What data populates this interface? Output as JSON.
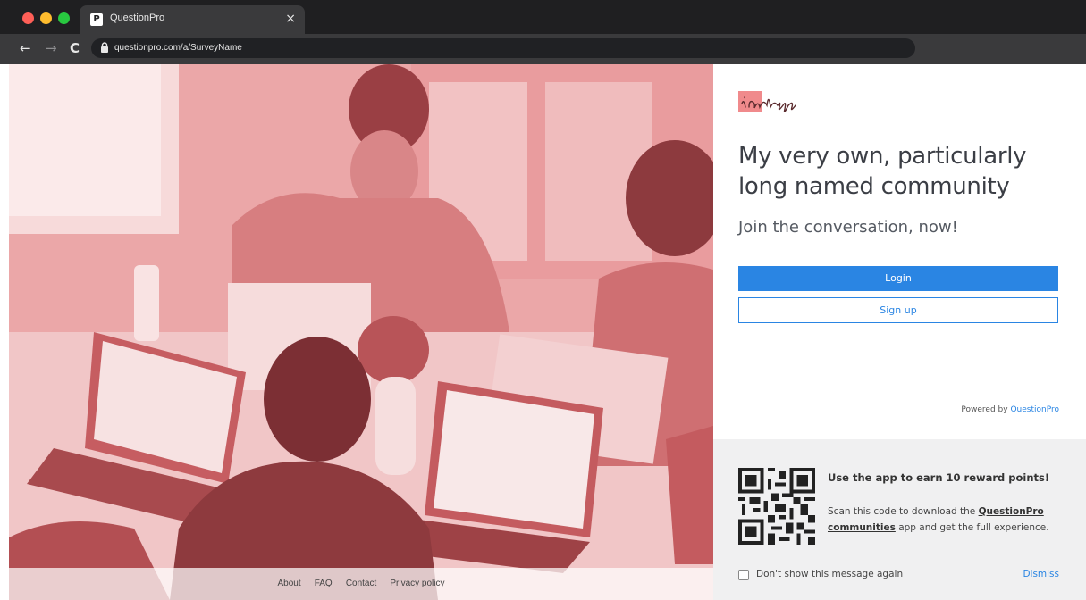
{
  "browser": {
    "tab_title": "QuestionPro",
    "tab_favicon": "P",
    "tab_close": "×",
    "url": "questionpro.com/a/SurveyName",
    "icons": [
      "back-arrow-icon",
      "forward-arrow-icon",
      "reload-icon",
      "lock-icon"
    ]
  },
  "hero": {
    "footer_links": [
      "About",
      "FAQ",
      "Contact",
      "Privacy policy"
    ],
    "tint_color": "#e8a5a6"
  },
  "panel": {
    "title": "My very own, particularly long named community",
    "subtitle": "Join the conversation, now!",
    "login_label": "Login",
    "signup_label": "Sign up",
    "powered_by_prefix": "Powered by",
    "powered_by_link": "QuestionPro",
    "accent_color": "#2a85e3"
  },
  "promo": {
    "title": "Use the  app to earn 10 reward points!",
    "text_before": "Scan this code to download the",
    "text_link": "QuestionPro communities",
    "text_after": "app and get the full experience.",
    "checkbox_label": "Don't show this message again",
    "dismiss_label": "Dismiss"
  }
}
